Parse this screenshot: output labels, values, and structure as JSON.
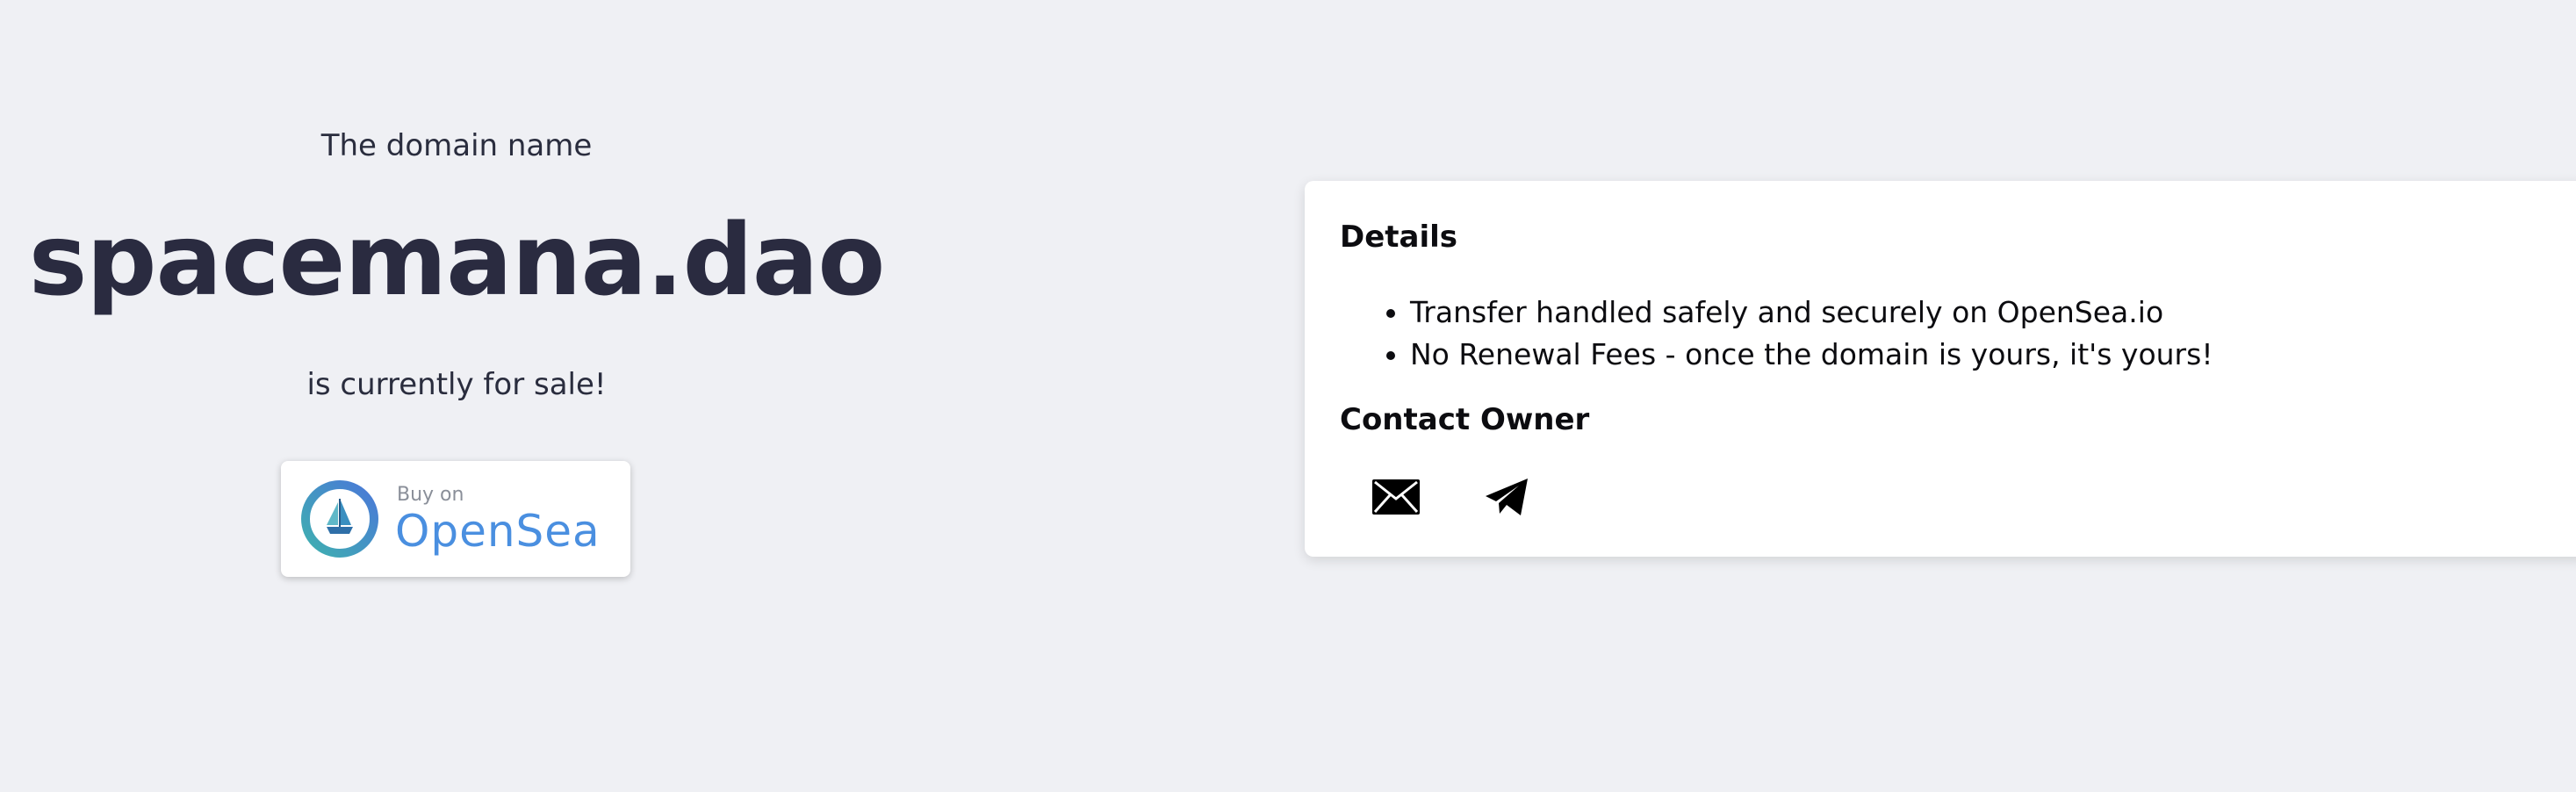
{
  "hero": {
    "intro": "The domain name",
    "domain": "spacemana.dao",
    "status": "is currently for sale!"
  },
  "buy_button": {
    "small_label": "Buy on",
    "brand": "OpenSea",
    "icon": "opensea-ship-icon",
    "brand_color": "#4a8fe0"
  },
  "details": {
    "title": "Details",
    "items": [
      "Transfer handled safely and securely on OpenSea.io",
      "No Renewal Fees - once the domain is yours, it's yours!"
    ]
  },
  "contact": {
    "title": "Contact Owner",
    "icons": [
      "envelope-icon",
      "telegram-icon"
    ]
  },
  "colors": {
    "background": "#eff0f4",
    "heading": "#2a2b40",
    "card": "#ffffff"
  }
}
